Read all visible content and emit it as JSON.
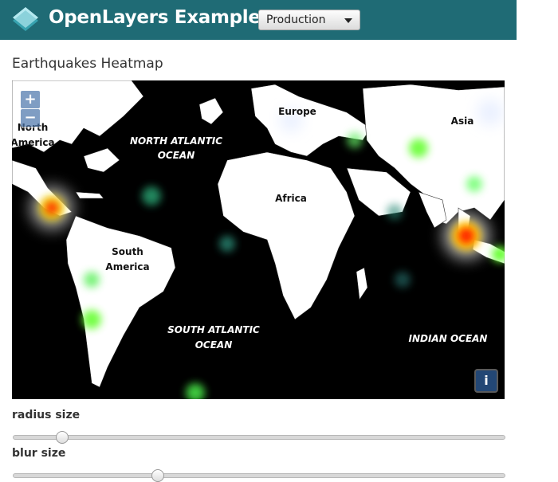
{
  "header": {
    "brand": "OpenLayers Examples",
    "version_selected": "Production",
    "background_color": "#1f6b75"
  },
  "page": {
    "title": "Earthquakes Heatmap"
  },
  "map": {
    "zoom_in": "+",
    "zoom_out": "−",
    "attribution": "i",
    "labels": {
      "north_america": [
        "North",
        "America"
      ],
      "south_america": [
        "South",
        "America"
      ],
      "europe": "Europe",
      "africa": "Africa",
      "asia": "Asia",
      "north_atlantic": [
        "NORTH ATLANTIC",
        "OCEAN"
      ],
      "south_atlantic": [
        "SOUTH ATLANTIC",
        "OCEAN"
      ],
      "indian_ocean": "INDIAN OCEAN"
    }
  },
  "controls": {
    "radius_label": "radius size",
    "radius_value": 0.09,
    "blur_label": "blur size",
    "blur_value": 0.29
  },
  "icons": {
    "logo": "openlayers-logo-icon",
    "caret": "chevron-down-icon",
    "info": "info-icon"
  }
}
